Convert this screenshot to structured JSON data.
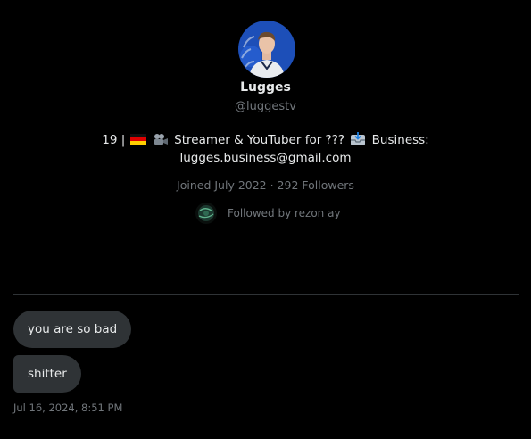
{
  "profile": {
    "name": "Lugges",
    "handle": "@luggestv",
    "bio": {
      "prefix": "19 |",
      "text1": "Streamer & YouTuber for ???",
      "text2": "Business:",
      "email": "lugges.business@gmail.com"
    },
    "joined": "Joined July 2022 · 292 Followers",
    "followed_by": "Followed by rezon ay"
  },
  "messages": [
    {
      "text": "you are so bad"
    },
    {
      "text": "shitter"
    }
  ],
  "timestamp": "Jul 16, 2024, 8:51 PM",
  "colors": {
    "background": "#000000",
    "text": "#e7e9ea",
    "muted": "#71767b",
    "bubble": "#2f3336",
    "avatar_bg": "#1d4fb8"
  },
  "icons": [
    "germany-flag-icon",
    "movie-camera-icon",
    "inbox-tray-icon"
  ]
}
